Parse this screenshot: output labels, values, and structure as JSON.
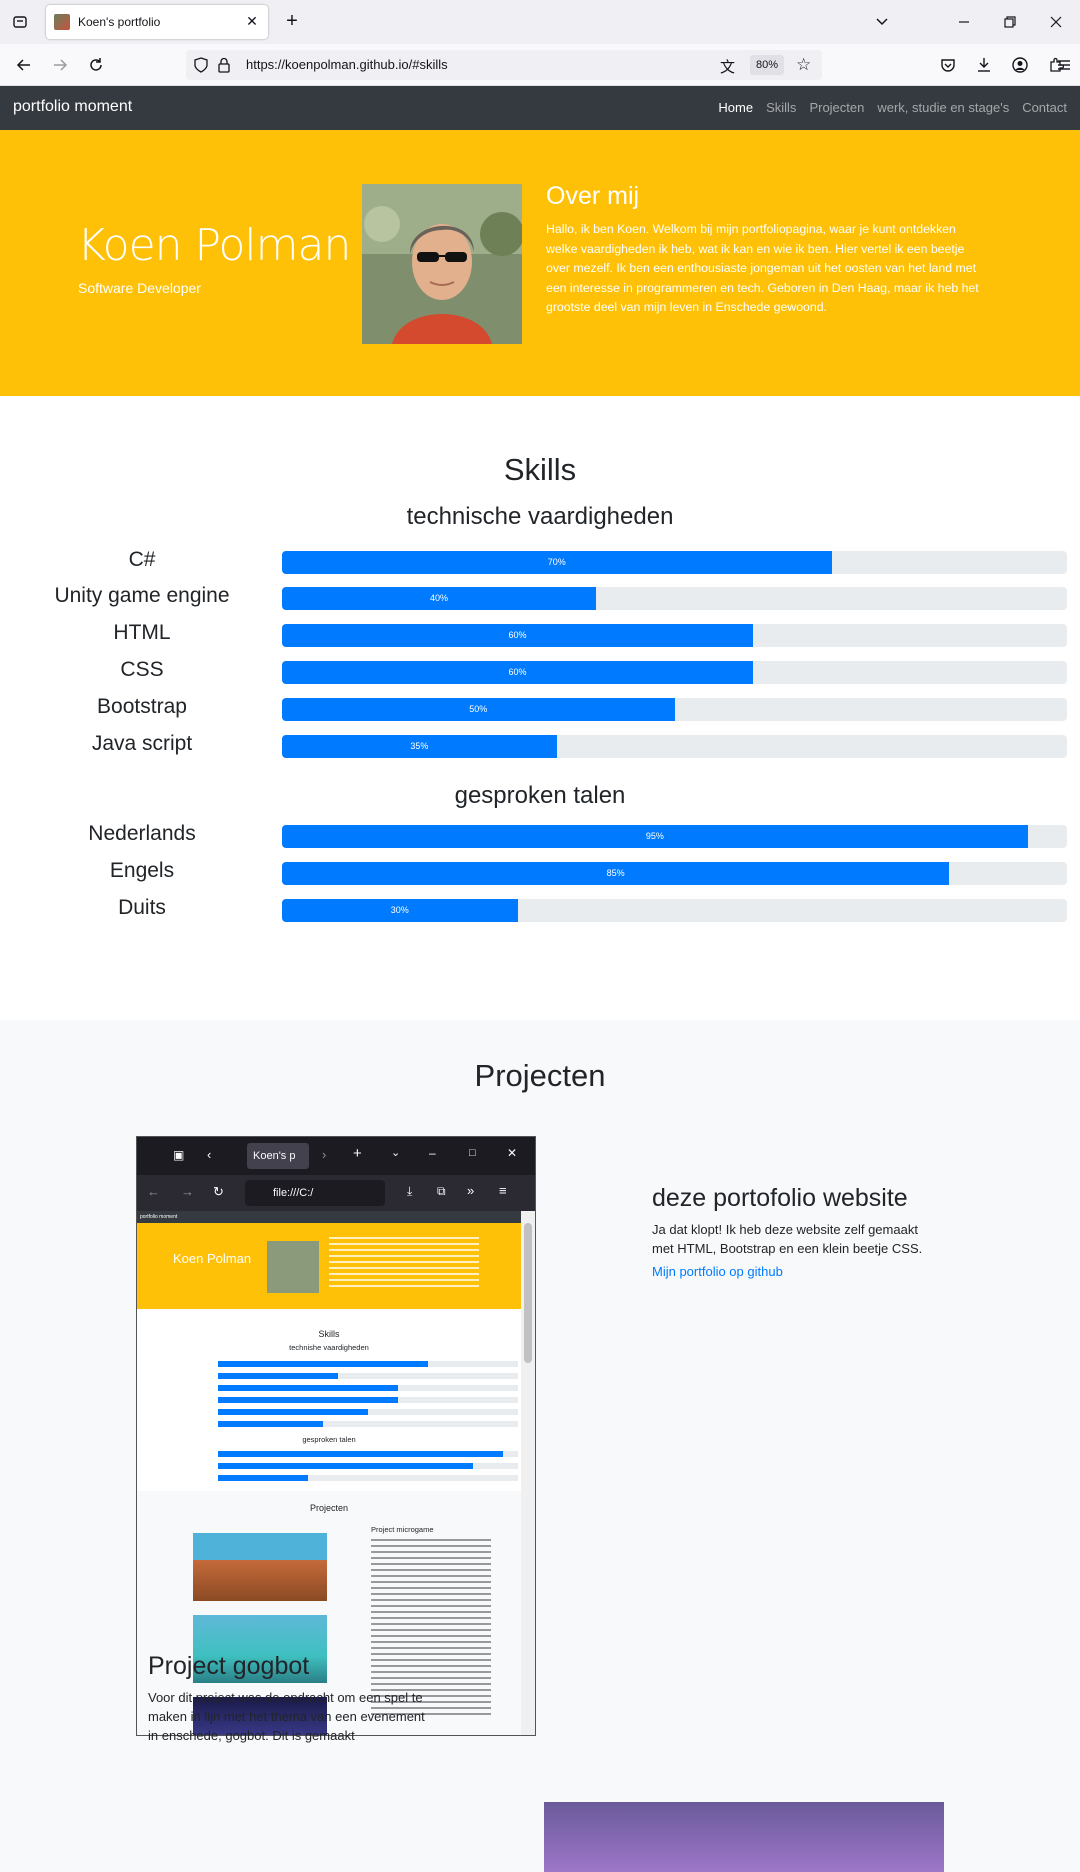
{
  "browser": {
    "tab_title": "Koen's portfolio",
    "url": "https://koenpolman.github.io/#skills",
    "zoom": "80%"
  },
  "site": {
    "brand": "portfolio moment",
    "nav": [
      "Home",
      "Skills",
      "Projecten",
      "werk, studie en stage's",
      "Contact"
    ]
  },
  "hero": {
    "name": "Koen Polman",
    "role": "Software Developer",
    "about_title": "Over mij",
    "about_text": "Hallo, ik ben Koen. Welkom bij mijn portfoliopagina, waar je kunt ontdekken welke vaardigheden ik heb, wat ik kan en wie ik ben. Hier vertel ik een beetje over mezelf. Ik ben een enthousiaste jongeman uit het oosten van het land met een interesse in programmeren en tech. Geboren in Den Haag, maar ik heb het grootste deel van mijn leven in Enschede gewoond."
  },
  "skills": {
    "title": "Skills",
    "technical_title": "technische vaardigheden",
    "technical": [
      {
        "name": "C#",
        "percent": 70,
        "label": "70%"
      },
      {
        "name": "Unity game engine",
        "percent": 40,
        "label": "40%"
      },
      {
        "name": "HTML",
        "percent": 60,
        "label": "60%"
      },
      {
        "name": "CSS",
        "percent": 60,
        "label": "60%"
      },
      {
        "name": "Bootstrap",
        "percent": 50,
        "label": "50%"
      },
      {
        "name": "Java script",
        "percent": 35,
        "label": "35%"
      }
    ],
    "languages_title": "gesproken talen",
    "languages": [
      {
        "name": "Nederlands",
        "percent": 95,
        "label": "95%"
      },
      {
        "name": "Engels",
        "percent": 85,
        "label": "85%"
      },
      {
        "name": "Duits",
        "percent": 30,
        "label": "30%"
      }
    ]
  },
  "projects": {
    "title": "Projecten",
    "p1_title": "deze portofolio website",
    "p1_text": "Ja dat klopt! Ik heb deze website zelf gemaakt met HTML, Bootstrap en een klein beetje CSS.",
    "p1_link": "Mijn portfolio op github",
    "p2_title": "Project gogbot",
    "p2_text": "Voor dit project was de opdracht om een spel te maken in lijn met het thema van een evenement in enschede, gogbot. Dit is gemaakt"
  },
  "screenshot": {
    "tab_title": "Koen's p",
    "url": "file:///C:/",
    "brand": "portfolio moment",
    "name": "Koen Polman",
    "skills_title": "Skills",
    "technical_title": "technishe vaardigheden",
    "languages_title": "gesproken talen",
    "projects_title": "Projecten",
    "project_title": "Project microgame"
  },
  "colors": {
    "accent": "#007bff",
    "hero": "#ffc107",
    "nav": "#343a40"
  }
}
